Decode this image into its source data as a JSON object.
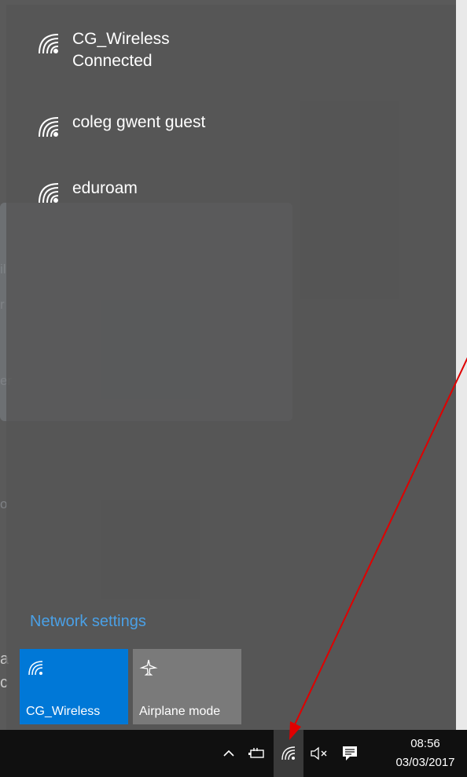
{
  "background": {
    "fragments": [
      "il",
      "r",
      "er",
      "o",
      "a",
      "c"
    ]
  },
  "flyout": {
    "networks": [
      {
        "name": "CG_Wireless",
        "status": "Connected",
        "icon": "wifi-icon"
      },
      {
        "name": "coleg gwent guest",
        "status": "",
        "icon": "wifi-icon"
      },
      {
        "name": "eduroam",
        "status": "",
        "icon": "wifi-icon"
      }
    ],
    "network_settings_label": "Network settings",
    "tiles": [
      {
        "label": "CG_Wireless",
        "icon": "wifi-icon",
        "state": "on",
        "color": "#0078d7"
      },
      {
        "label": "Airplane mode",
        "icon": "airplane-icon",
        "state": "off",
        "color": "#7a7a7a"
      }
    ]
  },
  "taskbar": {
    "tray_icons": [
      "chevron-up-icon",
      "battery-icon",
      "wifi-icon",
      "volume-muted-icon",
      "action-center-icon"
    ],
    "time": "08:56",
    "date": "03/03/2017"
  },
  "annotation": {
    "color": "#e00000"
  }
}
